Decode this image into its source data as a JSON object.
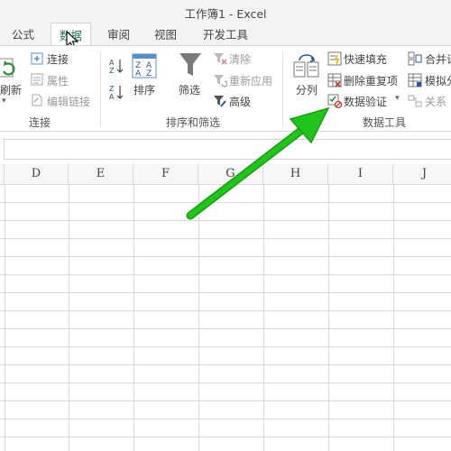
{
  "window": {
    "title": "工作簿1 - Excel"
  },
  "tabs": [
    "公式",
    "数据",
    "审阅",
    "视图",
    "开发工具"
  ],
  "active_tab": "数据",
  "ribbon": {
    "connections": {
      "refresh_all": "刷新",
      "connections": "连接",
      "properties": "属性",
      "edit_links": "编辑链接",
      "group_label": "连接"
    },
    "sort_filter": {
      "sort": "排序",
      "filter": "筛选",
      "clear": "清除",
      "reapply": "重新应用",
      "advanced": "高级",
      "group_label": "排序和筛选"
    },
    "data_tools": {
      "text_to_columns": "分列",
      "flash_fill": "快速填充",
      "remove_duplicates": "删除重复项",
      "data_validation": "数据验证",
      "consolidate": "合并计",
      "what_if": "模拟分",
      "relationships": "关系",
      "group_label": "数据工具"
    }
  },
  "columns": [
    "D",
    "E",
    "F",
    "G",
    "H",
    "I",
    "J"
  ],
  "colors": {
    "accent": "#217346",
    "arrow": "#22c41c"
  }
}
